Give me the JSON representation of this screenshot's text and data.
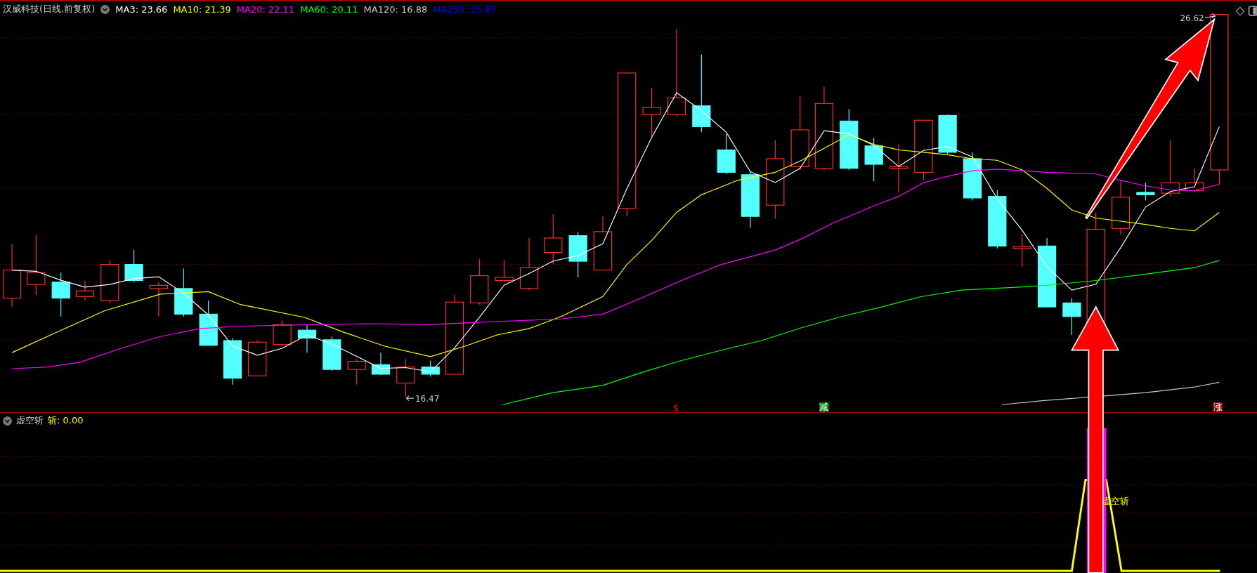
{
  "main_panel": {
    "title": "汉威科技(日线,前复权)",
    "indicators": [
      {
        "label": "MA3: 23.66",
        "color": "#ffffff"
      },
      {
        "label": "MA10: 21.39",
        "color": "#ffff00"
      },
      {
        "label": "MA20: 22.11",
        "color": "#ff00ff"
      },
      {
        "label": "MA60: 20.11",
        "color": "#00ff00"
      },
      {
        "label": "MA120: 16.88",
        "color": "#c8c8c8"
      },
      {
        "label": "MA250: 15.87",
        "color": "#0000ff"
      }
    ],
    "high_label": "26.62",
    "low_label": "16.47",
    "signals": [
      {
        "kind": "plain",
        "text": "$",
        "color": "#ff0000"
      },
      {
        "kind": "box",
        "text": "减",
        "color": "#008000"
      },
      {
        "kind": "box",
        "text": "涨",
        "color": "#800000"
      }
    ]
  },
  "lower_panel": {
    "title": "虚空斩",
    "reading": "斩: 0.00",
    "signal_label": "虚空斩"
  }
}
